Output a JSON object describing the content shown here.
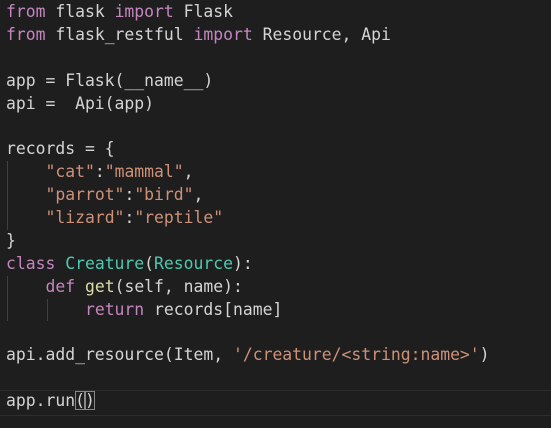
{
  "editor": {
    "colors": {
      "background": "#1e1e1e",
      "keyword": "#c586c0",
      "class_name": "#4ec9b0",
      "function": "#dcdcaa",
      "string": "#ce9178",
      "text": "#d4d4d4"
    },
    "lines": [
      {
        "t": [
          {
            "c": "kw",
            "v": "from"
          },
          {
            "c": "plain",
            "v": " flask "
          },
          {
            "c": "kw",
            "v": "import"
          },
          {
            "c": "plain",
            "v": " Flask"
          }
        ]
      },
      {
        "t": [
          {
            "c": "kw",
            "v": "from"
          },
          {
            "c": "plain",
            "v": " flask_restful "
          },
          {
            "c": "kw",
            "v": "import"
          },
          {
            "c": "plain",
            "v": " Resource, Api"
          }
        ]
      },
      {
        "t": []
      },
      {
        "t": [
          {
            "c": "plain",
            "v": "app = Flask(__name__)"
          }
        ]
      },
      {
        "t": [
          {
            "c": "plain",
            "v": "api =  Api(app)"
          }
        ]
      },
      {
        "t": []
      },
      {
        "t": [
          {
            "c": "plain",
            "v": "records = {"
          }
        ]
      },
      {
        "g": 1,
        "t": [
          {
            "c": "plain",
            "v": "    "
          },
          {
            "c": "str",
            "v": "\"cat\""
          },
          {
            "c": "plain",
            "v": ":"
          },
          {
            "c": "str",
            "v": "\"mammal\""
          },
          {
            "c": "plain",
            "v": ","
          }
        ]
      },
      {
        "g": 1,
        "t": [
          {
            "c": "plain",
            "v": "    "
          },
          {
            "c": "str",
            "v": "\"parrot\""
          },
          {
            "c": "plain",
            "v": ":"
          },
          {
            "c": "str",
            "v": "\"bird\""
          },
          {
            "c": "plain",
            "v": ","
          }
        ]
      },
      {
        "g": 1,
        "t": [
          {
            "c": "plain",
            "v": "    "
          },
          {
            "c": "str",
            "v": "\"lizard\""
          },
          {
            "c": "plain",
            "v": ":"
          },
          {
            "c": "str",
            "v": "\"reptile\""
          }
        ]
      },
      {
        "t": [
          {
            "c": "plain",
            "v": "}"
          }
        ]
      },
      {
        "t": [
          {
            "c": "kw",
            "v": "class"
          },
          {
            "c": "plain",
            "v": " "
          },
          {
            "c": "cls",
            "v": "Creature"
          },
          {
            "c": "plain",
            "v": "("
          },
          {
            "c": "cls",
            "v": "Resource"
          },
          {
            "c": "plain",
            "v": "):"
          }
        ]
      },
      {
        "g": 1,
        "t": [
          {
            "c": "plain",
            "v": "    "
          },
          {
            "c": "kw",
            "v": "def"
          },
          {
            "c": "plain",
            "v": " "
          },
          {
            "c": "fn",
            "v": "get"
          },
          {
            "c": "plain",
            "v": "(self, name):"
          }
        ]
      },
      {
        "g": 2,
        "t": [
          {
            "c": "plain",
            "v": "        "
          },
          {
            "c": "kw",
            "v": "return"
          },
          {
            "c": "plain",
            "v": " records[name]"
          }
        ]
      },
      {
        "t": []
      },
      {
        "t": [
          {
            "c": "plain",
            "v": "api.add_resource(Item, "
          },
          {
            "c": "str",
            "v": "'/creature/<string:name>'"
          },
          {
            "c": "plain",
            "v": ")"
          }
        ]
      },
      {
        "t": []
      },
      {
        "t": [
          {
            "c": "plain",
            "v": "app.run"
          },
          {
            "c": "plain bracket-box",
            "v": "("
          },
          {
            "c": "plain bracket-box",
            "v": ")"
          }
        ]
      }
    ]
  }
}
